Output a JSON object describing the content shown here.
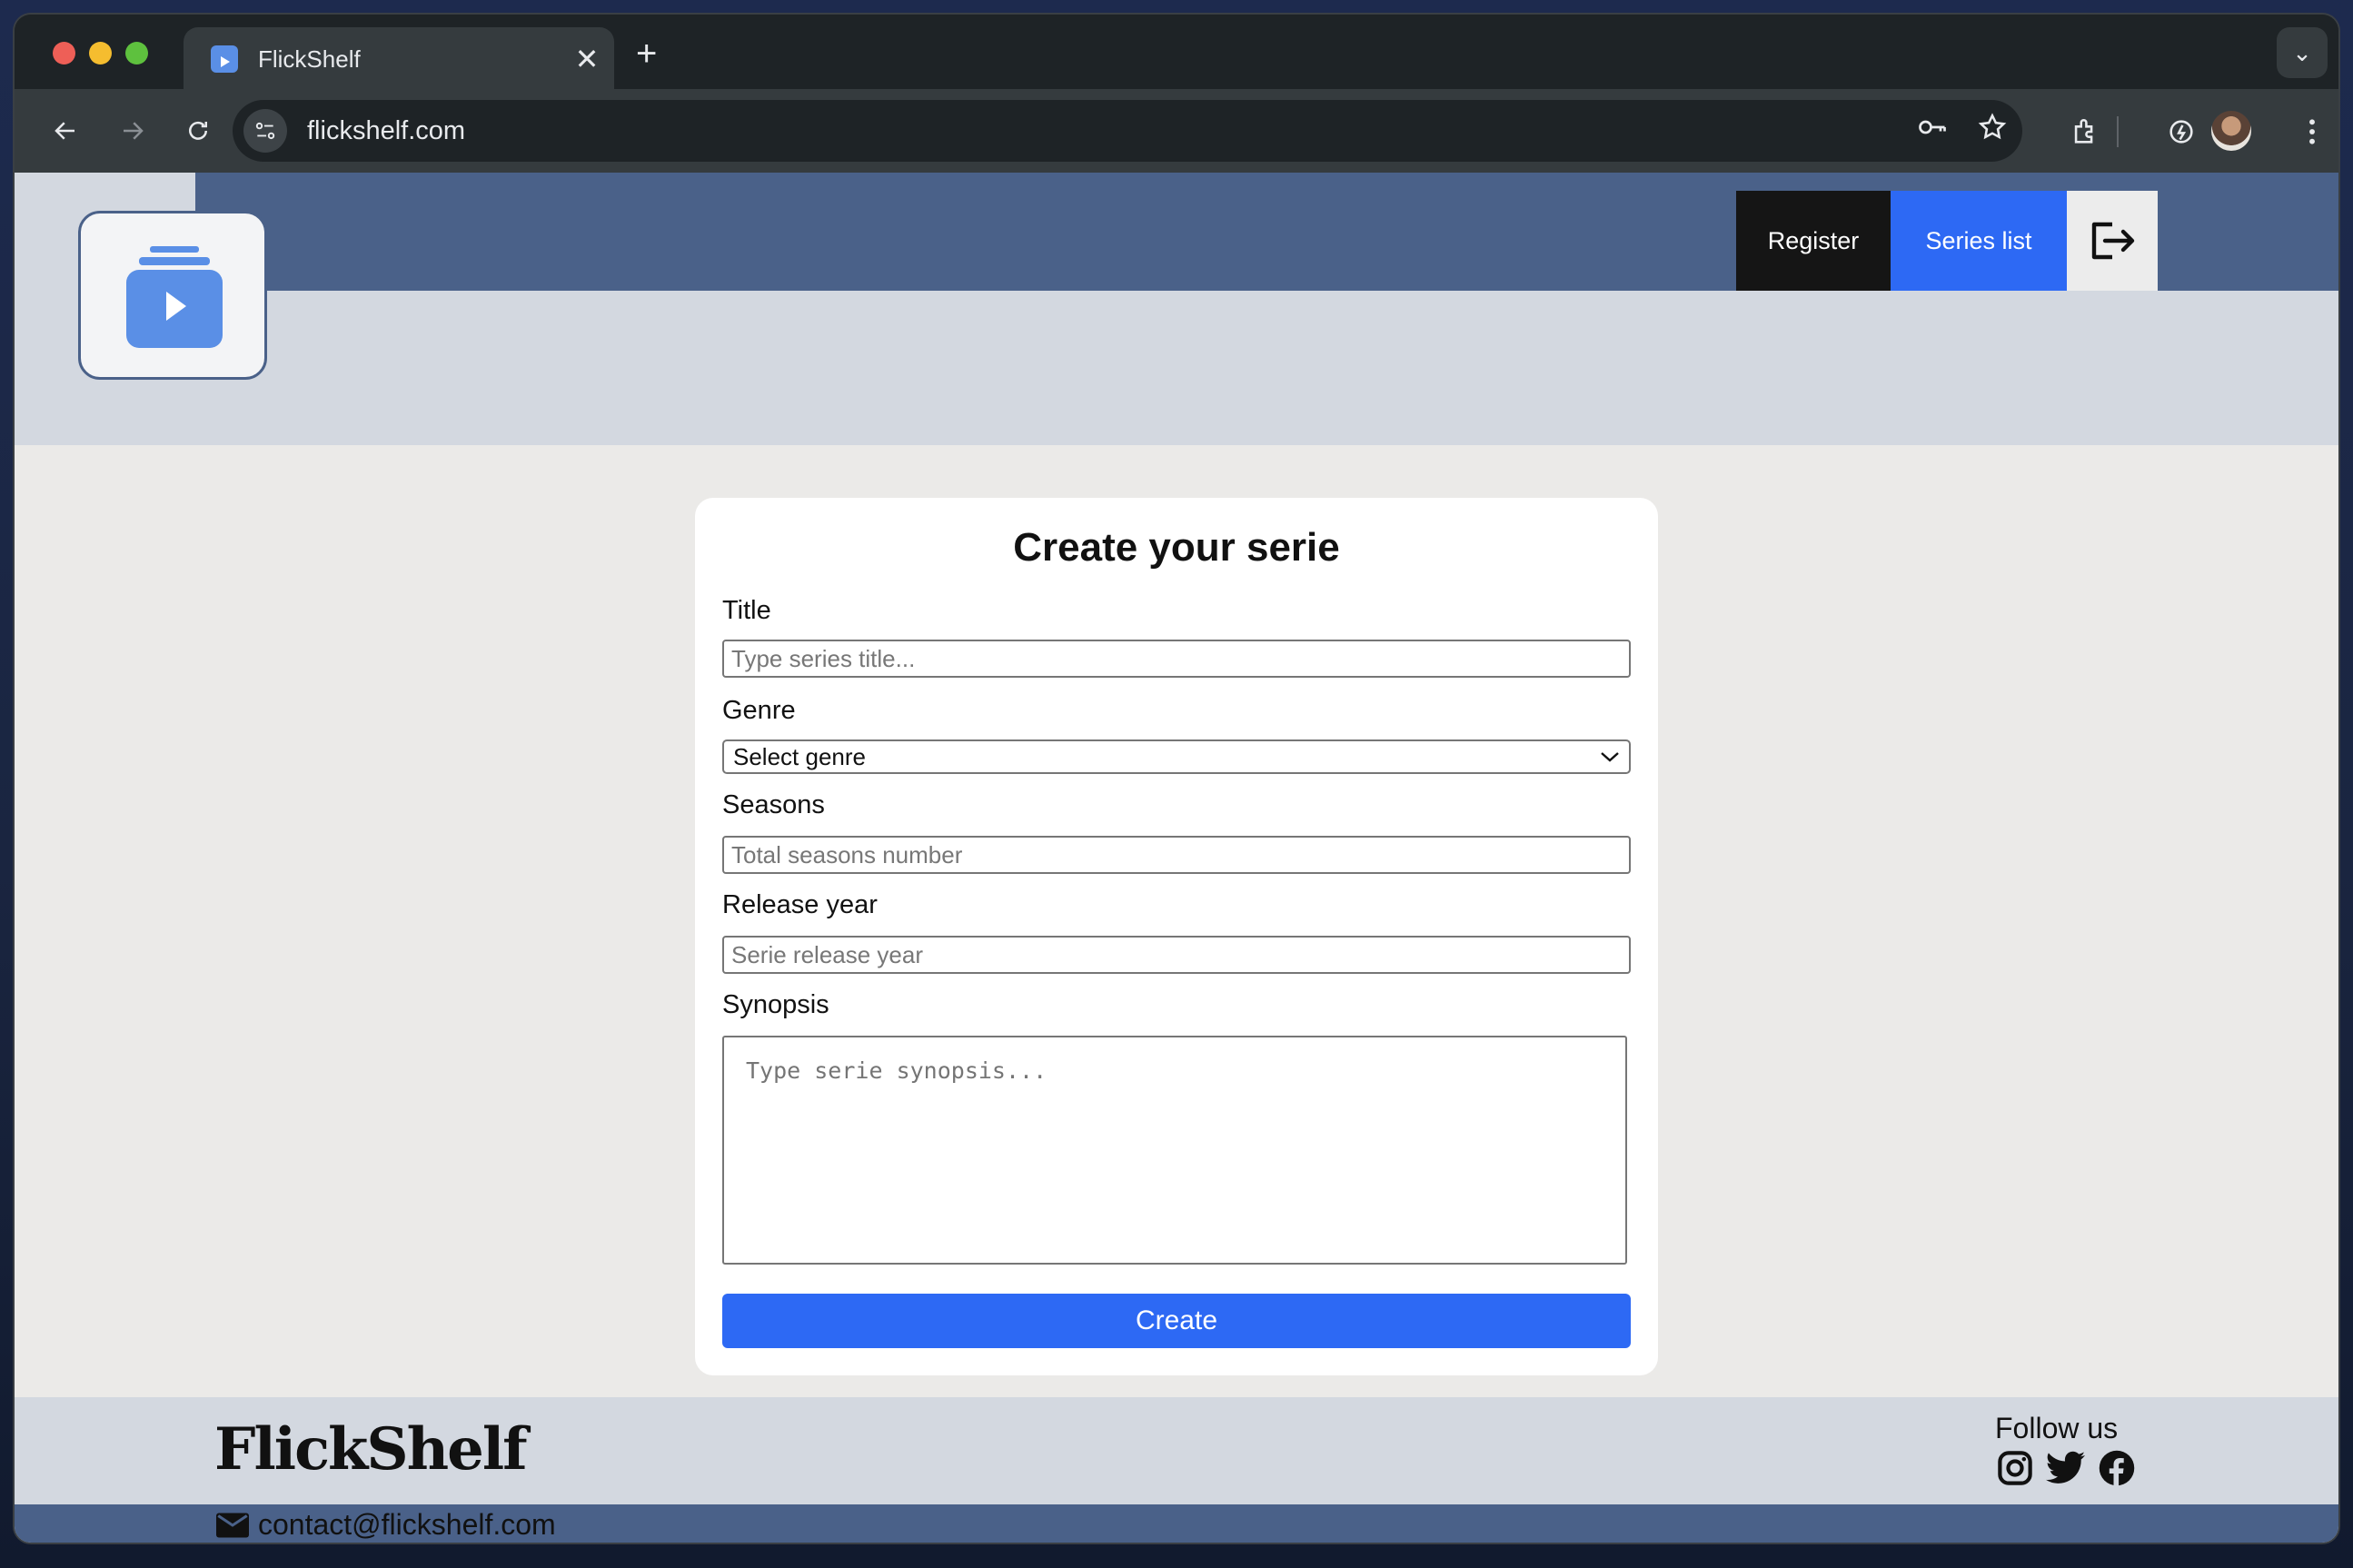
{
  "browser": {
    "tab_title": "FlickShelf",
    "tab_close": "✕",
    "new_tab": "+",
    "tab_search": "⌄",
    "url": "flickshelf.com",
    "icons": [
      "back-icon",
      "forward-icon",
      "reload-icon",
      "site-info-icon",
      "password-key-icon",
      "bookmark-star-icon",
      "extensions-icon",
      "performance-icon",
      "profile-avatar",
      "menu-icon"
    ]
  },
  "header": {
    "nav": {
      "register": "Register",
      "series_list": "Series list"
    },
    "colors": {
      "header_bar": "#4a6189",
      "register_bg": "#151515",
      "series_bg": "#2d69f4"
    }
  },
  "form": {
    "title": "Create your serie",
    "fields": {
      "title_label": "Title",
      "title_placeholder": "Type series title...",
      "genre_label": "Genre",
      "genre_selected": "Select genre",
      "seasons_label": "Seasons",
      "seasons_placeholder": "Total seasons number",
      "release_label": "Release year",
      "release_placeholder": "Serie release year",
      "synopsis_label": "Synopsis",
      "synopsis_placeholder": "Type serie synopsis..."
    },
    "submit": "Create"
  },
  "footer": {
    "brand": "FlickShelf",
    "follow": "Follow us",
    "socials": [
      "instagram-icon",
      "twitter-icon",
      "facebook-icon"
    ],
    "email": "contact@flickshelf.com"
  }
}
